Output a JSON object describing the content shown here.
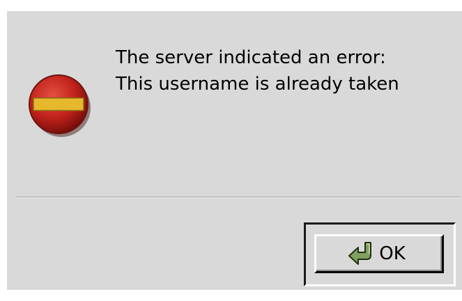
{
  "dialog": {
    "icon": "stop-icon",
    "message_line1": "The server indicated an error:",
    "message_line2": "This username is already taken",
    "ok_button_label": "OK",
    "ok_button_icon": "ok-arrow-icon"
  },
  "colors": {
    "background": "#d9d9d9",
    "stop_red": "#c0221c",
    "stop_bar": "#e6b82e",
    "ok_icon_green": "#7fa060"
  }
}
